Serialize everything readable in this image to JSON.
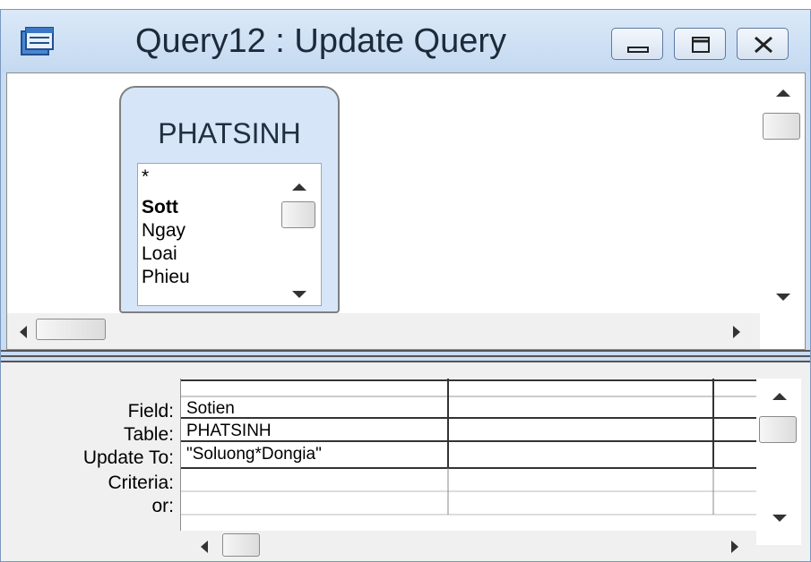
{
  "window": {
    "title": "Query12 : Update Query"
  },
  "table_box": {
    "name": "PHATSINH",
    "fields": [
      "*",
      "Sott",
      "Ngay",
      "Loai",
      "Phieu"
    ]
  },
  "grid": {
    "row_labels": [
      "Field:",
      "Table:",
      "Update To:",
      "Criteria:",
      "or:"
    ],
    "columns": [
      {
        "field": "Sotien",
        "table": "PHATSINH",
        "update_to": "\"Soluong*Dongia\"",
        "criteria": "",
        "or": ""
      },
      {
        "field": "",
        "table": "",
        "update_to": "",
        "criteria": "",
        "or": ""
      }
    ]
  },
  "icons": [
    "query-window-icon",
    "minimize-icon",
    "maximize-icon",
    "close-icon",
    "scroll-up-icon",
    "scroll-down-icon",
    "scroll-left-icon",
    "scroll-right-icon"
  ]
}
